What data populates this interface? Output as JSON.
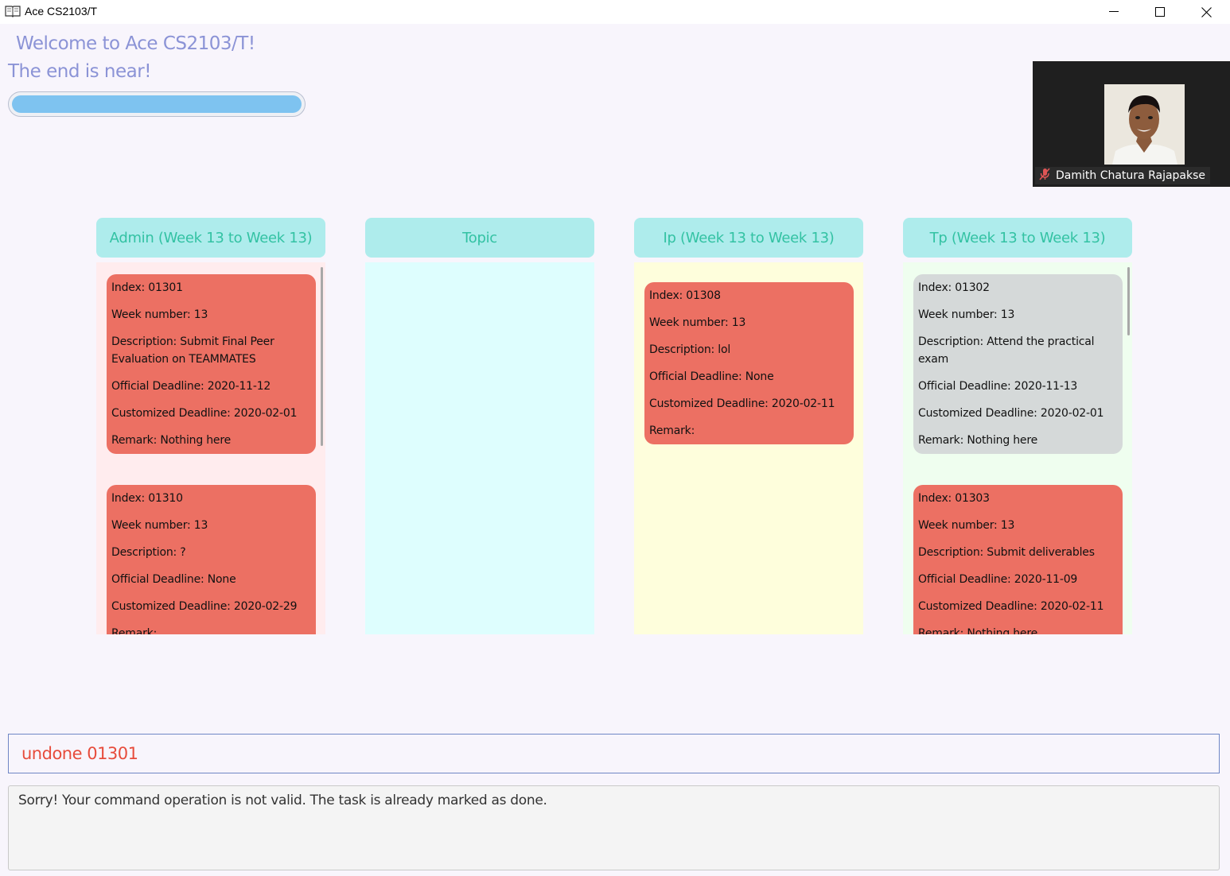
{
  "window": {
    "title": "Ace CS2103/T",
    "icon": "book-icon"
  },
  "header": {
    "welcome": "Welcome to Ace CS2103/T!",
    "subtitle": "The end is near!",
    "progress_fraction": 1.0
  },
  "video": {
    "participant_name": "Damith Chatura Rajapakse",
    "mic_status": "muted"
  },
  "columns": [
    {
      "title": "Admin (Week 13 to Week 13)",
      "bg": "#ffecee",
      "cards": [
        {
          "color": "red",
          "lines": [
            "Index: 01301",
            "Week number: 13",
            "Description: Submit Final Peer Evaluation on TEAMMATES",
            "Official Deadline: 2020-11-12",
            "Customized Deadline: 2020-02-01",
            "Remark: Nothing here"
          ]
        },
        {
          "color": "red",
          "lines": [
            "Index: 01310",
            "Week number: 13",
            "Description: ?",
            "Official Deadline: None",
            "Customized Deadline: 2020-02-29",
            "Remark:"
          ]
        }
      ]
    },
    {
      "title": "Topic",
      "bg": "#defefe",
      "cards": []
    },
    {
      "title": "Ip (Week 13 to Week 13)",
      "bg": "#fefedc",
      "cards": [
        {
          "color": "red",
          "lines": [
            "Index: 01308",
            "Week number: 13",
            "Description: lol",
            "Official Deadline: None",
            "Customized Deadline: 2020-02-11",
            "Remark:"
          ]
        }
      ]
    },
    {
      "title": "Tp (Week 13 to Week 13)",
      "bg": "#effeef",
      "cards": [
        {
          "color": "grey",
          "lines": [
            "Index: 01302",
            "Week number: 13",
            "Description: Attend the practical exam",
            "Official Deadline: 2020-11-13",
            "Customized Deadline: 2020-02-01",
            "Remark: Nothing here"
          ]
        },
        {
          "color": "red",
          "lines": [
            "Index: 01303",
            "Week number: 13",
            "Description: Submit deliverables",
            "Official Deadline: 2020-11-09",
            "Customized Deadline: 2020-02-11",
            "Remark: Nothing here"
          ]
        }
      ]
    }
  ],
  "command": {
    "value": "undone 01301"
  },
  "result": {
    "message": "Sorry! Your command operation is not valid. The task is already marked as done."
  }
}
